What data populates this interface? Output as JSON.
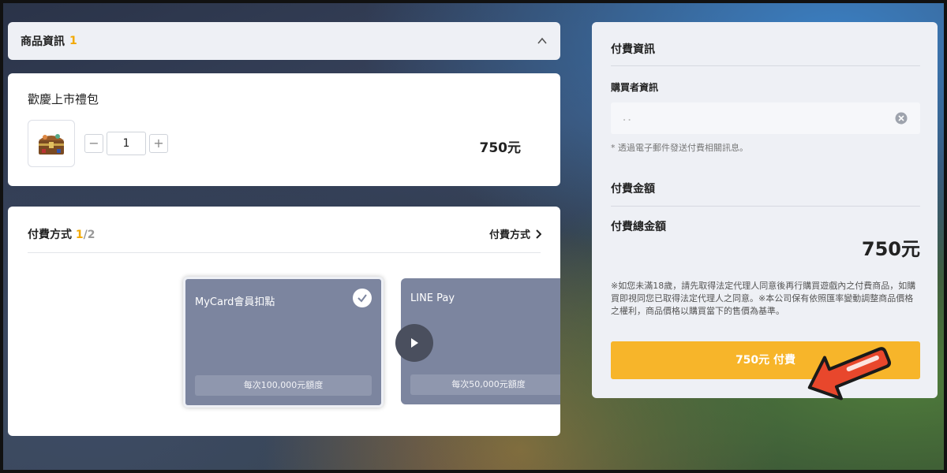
{
  "product_section": {
    "title": "商品資訊",
    "count": "1"
  },
  "product": {
    "name": "歡慶上市禮包",
    "quantity": "1",
    "minus": "−",
    "plus": "+",
    "price": "750元"
  },
  "payment_section": {
    "title": "付費方式",
    "page_current": "1",
    "page_total": "/2",
    "link_label": "付費方式",
    "methods": [
      {
        "name": "MyCard會員扣點",
        "limit": "每次100,000元額度",
        "selected": true
      },
      {
        "name": "LINE Pay",
        "limit": "每次50,000元額度",
        "selected": false
      }
    ]
  },
  "checkout": {
    "title": "付費資訊",
    "buyer_label": "購買者資訊",
    "email_value": "．．",
    "email_note": "* 透過電子郵件發送付費相關訊息。",
    "amount_title": "付費金額",
    "total_label": "付費總金額",
    "total_value": "750元",
    "disclaimer": "※如您未滿18歲，請先取得法定代理人同意後再行購買遊戲內之付費商品，如購買即視同您已取得法定代理人之同意。※本公司保有依照匯率變動調整商品價格之權利，商品價格以購買當下的售價為基準。",
    "pay_button": "750元 付費"
  },
  "colors": {
    "accent": "#f7b52a",
    "count_highlight": "#f3a900",
    "method_card": "#7c859f",
    "arrow": "#e8472c"
  }
}
